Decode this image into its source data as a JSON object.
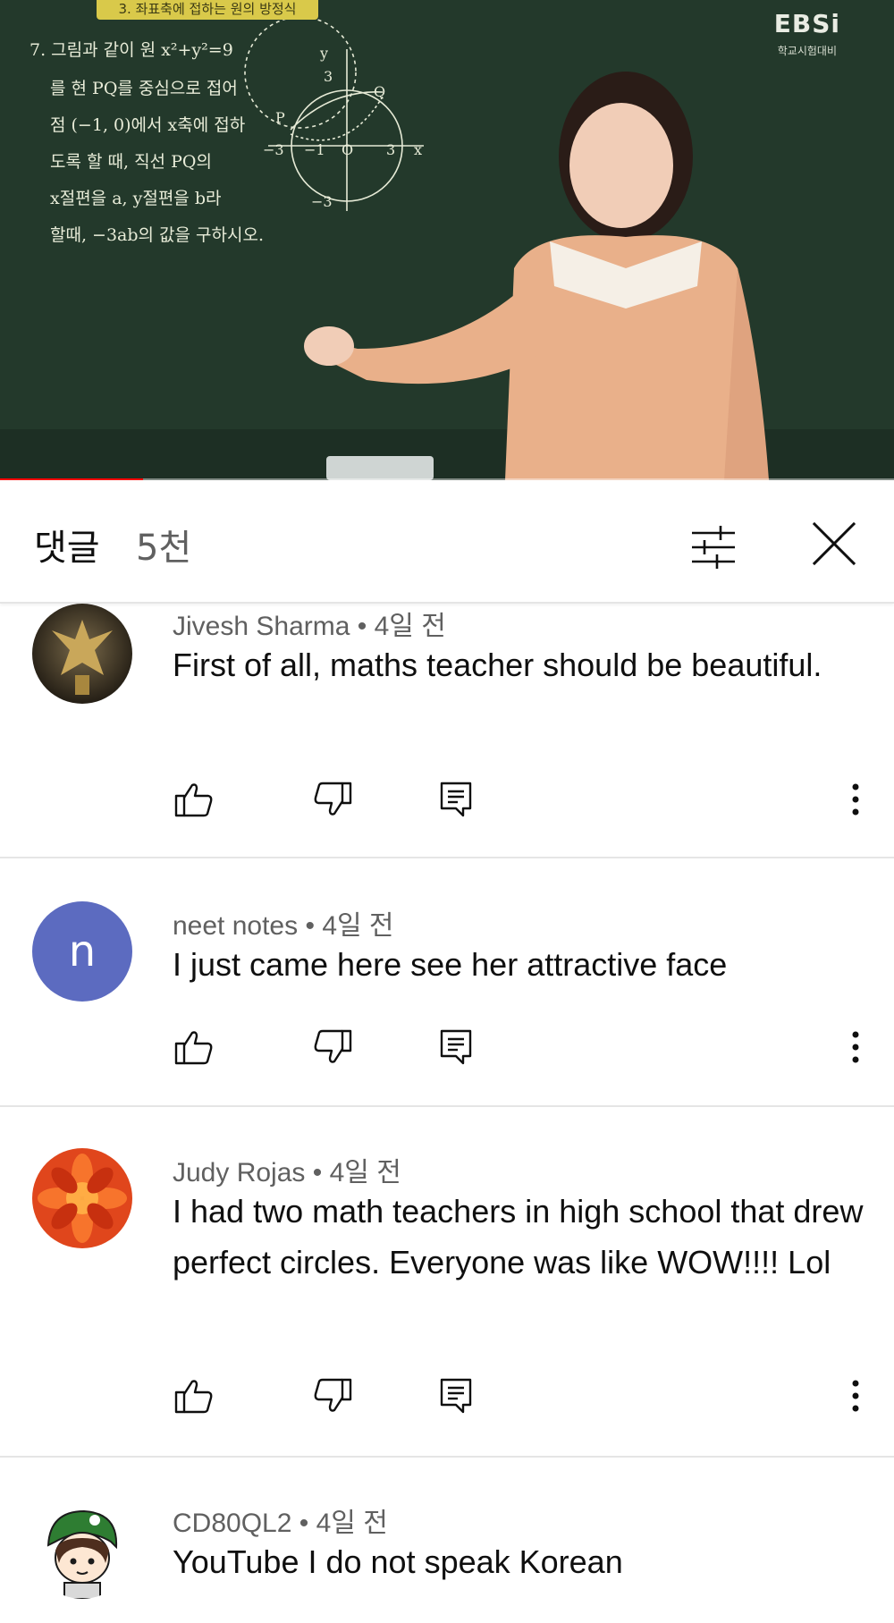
{
  "video": {
    "banner": "3. 좌표축에 접하는 원의 방정식",
    "logo": "EBSi",
    "logo_sub": "학교시험대비",
    "problem_lines": [
      "7. 그림과 같이 원 x²+y²=9",
      "를 현 PQ를 중심으로 접어",
      "점 (−1, 0)에서 x축에 접하",
      "도록 할 때, 직선 PQ의",
      "x절편을 a, y절편을 b라",
      "할때, −3ab의 값을 구하시오."
    ],
    "graph_labels": {
      "y_axis": "y",
      "x_axis": "x",
      "y_top": "3",
      "y_bottom": "−3",
      "x_left": "−3",
      "x_neg1": "−1",
      "origin": "O",
      "x_right": "3",
      "point_p": "P",
      "point_q": "Q"
    },
    "progress_fraction": 0.16,
    "progress_color": "#ff0000"
  },
  "header": {
    "title": "댓글",
    "count": "5천"
  },
  "icons": {
    "sort": "sort-icon",
    "close": "close-icon",
    "like": "thumbs-up-icon",
    "dislike": "thumbs-down-icon",
    "reply": "reply-icon",
    "more": "more-vertical-icon"
  },
  "comments": [
    {
      "author": "Jivesh Sharma",
      "age": "4일 전",
      "text": "First of all, maths teacher should be beautiful.",
      "avatar_type": "statue"
    },
    {
      "author": "neet notes",
      "age": "4일 전",
      "text": "I just came here see her attractive face",
      "avatar_type": "letter",
      "avatar_letter": "n",
      "avatar_color": "#5c6bc0"
    },
    {
      "author": "Judy Rojas",
      "age": "4일 전",
      "text": "I had two math teachers in high school that drew perfect circles. Everyone was like WOW!!!! Lol",
      "avatar_type": "flower"
    },
    {
      "author": "CD80QL2",
      "age": "4일 전",
      "text": "YouTube I do not speak Korean",
      "avatar_type": "cartoon"
    }
  ]
}
